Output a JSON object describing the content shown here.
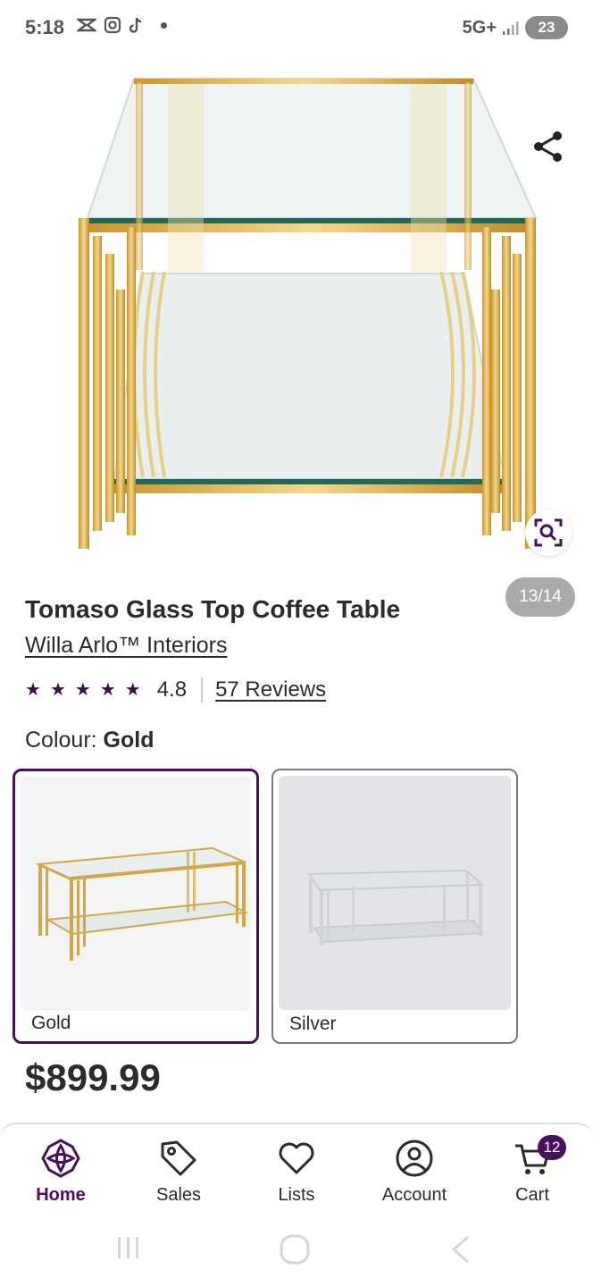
{
  "status_bar": {
    "time": "5:18",
    "network": "5G+",
    "battery": "23"
  },
  "gallery": {
    "counter": "13/14"
  },
  "product": {
    "title": "Tomaso Glass Top Coffee Table",
    "brand": "Willa Arlo™ Interiors",
    "rating": "4.8",
    "stars": 5,
    "reviews_link": "57 Reviews",
    "colour_label": "Colour:",
    "colour_selected": "Gold",
    "price": "$899.99"
  },
  "swatches": [
    {
      "label": "Gold",
      "selected": true
    },
    {
      "label": "Silver",
      "selected": false
    }
  ],
  "bottom_nav": {
    "items": [
      {
        "label": "Home",
        "icon": "home-logo-icon",
        "active": true
      },
      {
        "label": "Sales",
        "icon": "tag-icon",
        "active": false
      },
      {
        "label": "Lists",
        "icon": "heart-icon",
        "active": false
      },
      {
        "label": "Account",
        "icon": "account-icon",
        "active": false
      },
      {
        "label": "Cart",
        "icon": "cart-icon",
        "active": false
      }
    ],
    "cart_count": "12"
  },
  "colors": {
    "brand_purple": "#4a1060",
    "star": "#3b0d4f",
    "gold": "#d9b24c",
    "glass": "#e8efef"
  }
}
